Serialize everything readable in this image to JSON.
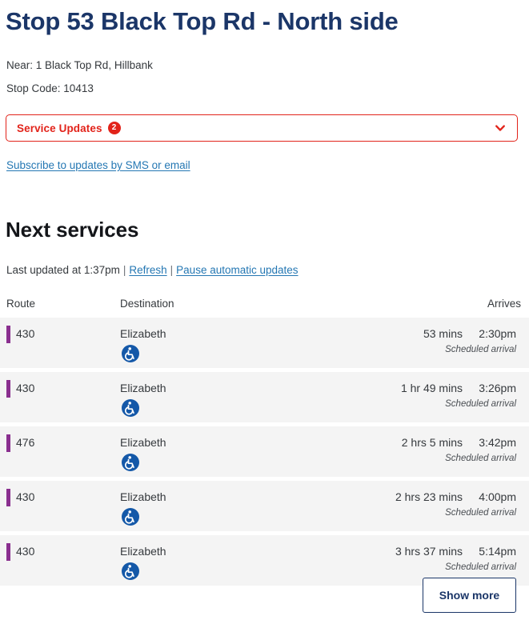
{
  "stop": {
    "title": "Stop 53 Black Top Rd - North side",
    "near": "Near: 1 Black Top Rd, Hillbank",
    "stop_code": "Stop Code: 10413"
  },
  "service_updates": {
    "label": "Service Updates",
    "count": "2",
    "chevron_icon": "chevron-down-icon",
    "accent_color": "#e2231a"
  },
  "subscribe": {
    "label": "Subscribe to updates by SMS or email"
  },
  "next_services": {
    "heading": "Next services",
    "last_updated": "Last updated at 1:37pm",
    "separator": "|",
    "refresh_label": "Refresh",
    "pause_label": "Pause automatic updates",
    "columns": {
      "route": "Route",
      "destination": "Destination",
      "arrives": "Arrives"
    },
    "route_bar_color": "#8a2f8f",
    "access_icon_color": "#1458a8",
    "rows": [
      {
        "route": "430",
        "destination": "Elizabeth",
        "accessible_icon": "wheelchair-accessible-icon",
        "wait": "53 mins",
        "time": "2:30pm",
        "note": "Scheduled arrival"
      },
      {
        "route": "430",
        "destination": "Elizabeth",
        "accessible_icon": "wheelchair-accessible-icon",
        "wait": "1 hr 49 mins",
        "time": "3:26pm",
        "note": "Scheduled arrival"
      },
      {
        "route": "476",
        "destination": "Elizabeth",
        "accessible_icon": "wheelchair-accessible-icon",
        "wait": "2 hrs 5 mins",
        "time": "3:42pm",
        "note": "Scheduled arrival"
      },
      {
        "route": "430",
        "destination": "Elizabeth",
        "accessible_icon": "wheelchair-accessible-icon",
        "wait": "2 hrs 23 mins",
        "time": "4:00pm",
        "note": "Scheduled arrival"
      },
      {
        "route": "430",
        "destination": "Elizabeth",
        "accessible_icon": "wheelchair-accessible-icon",
        "wait": "3 hrs 37 mins",
        "time": "5:14pm",
        "note": "Scheduled arrival"
      }
    ]
  },
  "show_more": {
    "label": "Show more"
  }
}
